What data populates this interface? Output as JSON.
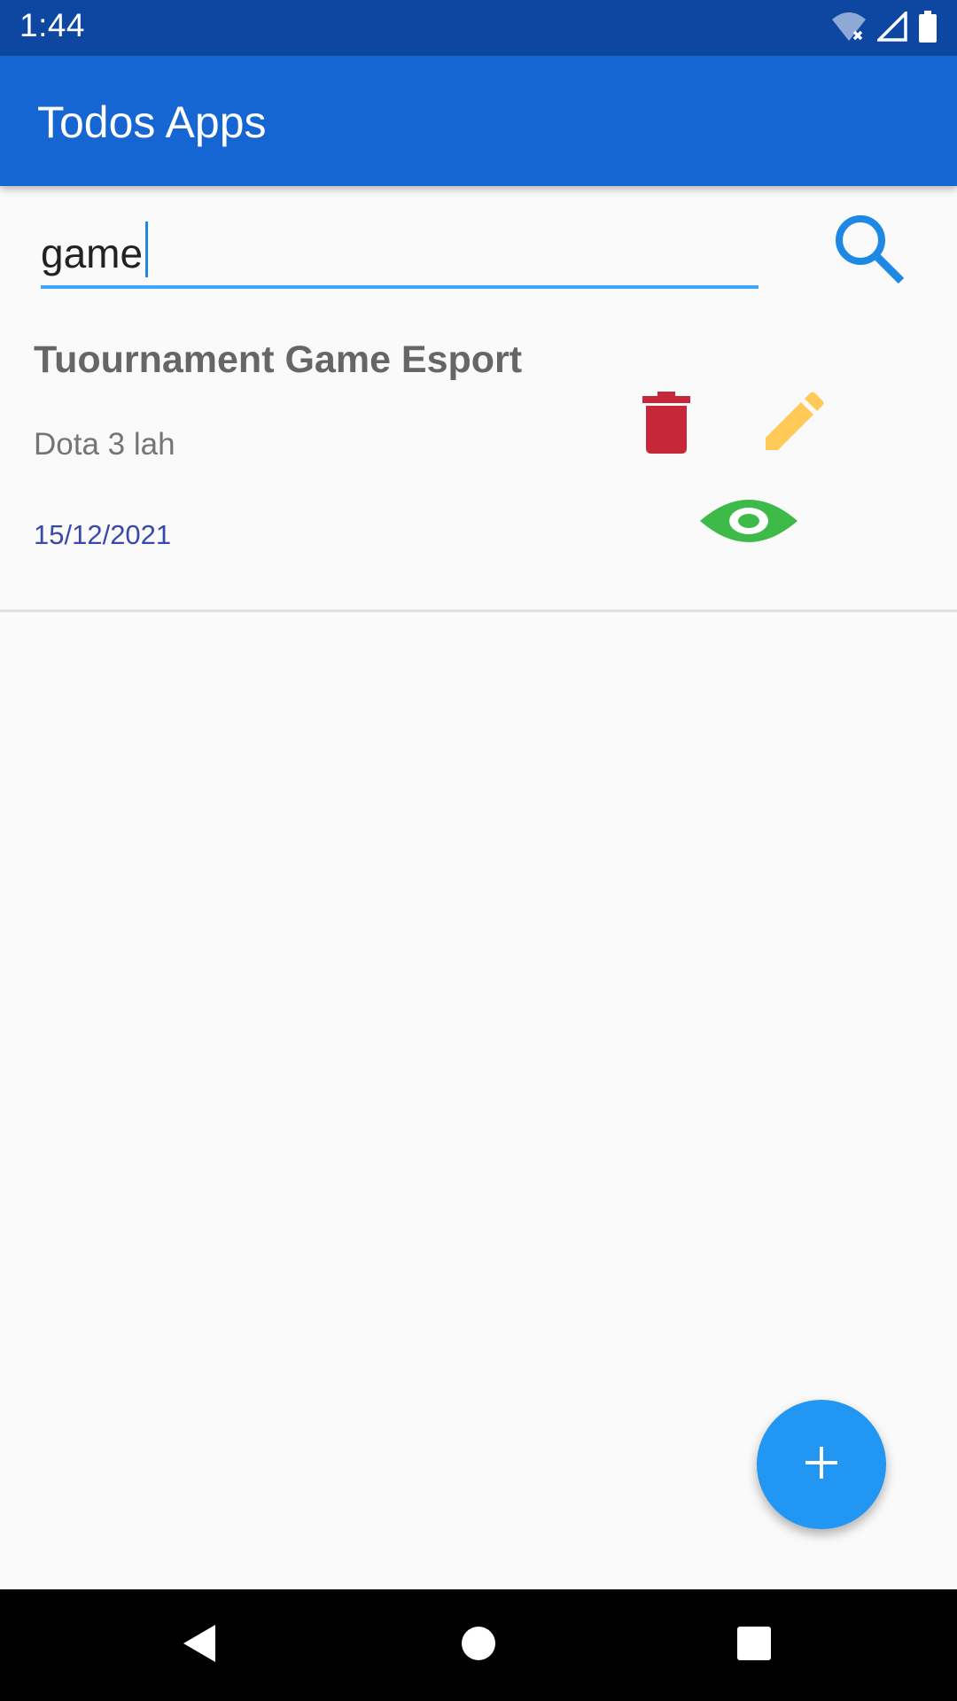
{
  "status_bar": {
    "time": "1:44",
    "icons": [
      "wifi-off-icon",
      "signal-icon",
      "battery-icon"
    ]
  },
  "app_bar": {
    "title": "Todos Apps"
  },
  "search": {
    "value": "game",
    "icon": "search-icon"
  },
  "todos": [
    {
      "title": "Tuournament Game Esport",
      "description": "Dota 3 lah",
      "date": "15/12/2021",
      "actions": [
        "trash-icon",
        "pencil-icon",
        "eye-icon"
      ]
    }
  ],
  "fab": {
    "icon": "plus-icon"
  },
  "nav_bar": {
    "buttons": [
      "back-icon",
      "home-icon",
      "recents-icon"
    ]
  },
  "colors": {
    "status_bar": "#0d47a1",
    "app_bar": "#1565d3",
    "accent": "#2196f3",
    "delete": "#c62839",
    "edit": "#ffca57",
    "view": "#3dba48",
    "date": "#3949ab"
  }
}
